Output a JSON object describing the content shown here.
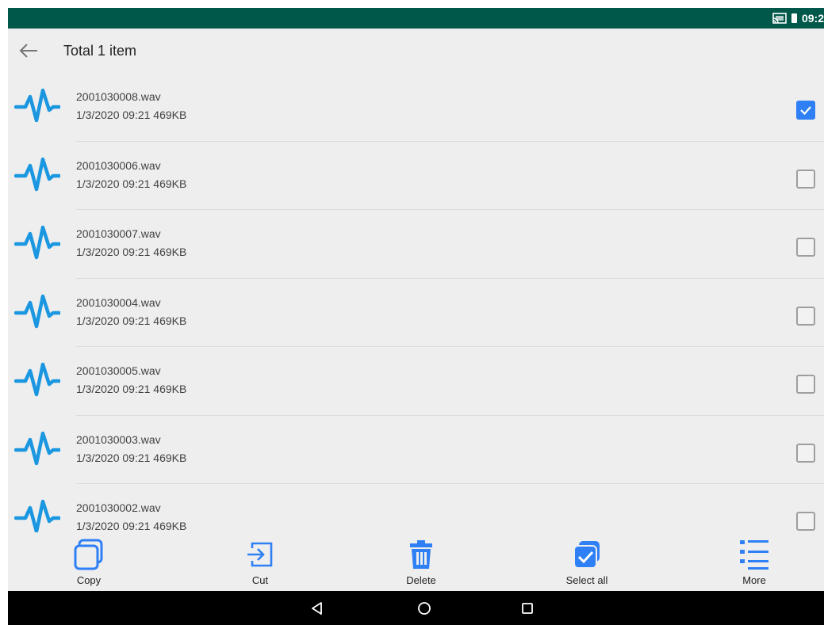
{
  "status_bar": {
    "time": "09:2",
    "icons": [
      "cast-icon",
      "battery-icon"
    ],
    "background": "#00584a"
  },
  "app_bar": {
    "title": "Total 1 item",
    "back_icon": "arrow-left-icon"
  },
  "colors": {
    "accent": "#2f7ff5",
    "wave_icon": "#1a97e0",
    "status_bar": "#00584a"
  },
  "files": [
    {
      "name": "2001030008.wav",
      "meta": "1/3/2020 09:21 469KB",
      "checked": true
    },
    {
      "name": "2001030006.wav",
      "meta": "1/3/2020 09:21 469KB",
      "checked": false
    },
    {
      "name": "2001030007.wav",
      "meta": "1/3/2020 09:21 469KB",
      "checked": false
    },
    {
      "name": "2001030004.wav",
      "meta": "1/3/2020 09:21 469KB",
      "checked": false
    },
    {
      "name": "2001030005.wav",
      "meta": "1/3/2020 09:21 469KB",
      "checked": false
    },
    {
      "name": "2001030003.wav",
      "meta": "1/3/2020 09:21 469KB",
      "checked": false
    },
    {
      "name": "2001030002.wav",
      "meta": "1/3/2020 09:21 469KB",
      "checked": false
    }
  ],
  "actions": [
    {
      "label": "Copy",
      "icon": "copy-icon"
    },
    {
      "label": "Cut",
      "icon": "cut-icon"
    },
    {
      "label": "Delete",
      "icon": "trash-icon"
    },
    {
      "label": "Select all",
      "icon": "select-all-icon"
    },
    {
      "label": "More",
      "icon": "list-icon"
    }
  ],
  "nav_bar": {
    "buttons": [
      "back-triangle-icon",
      "home-circle-icon",
      "recents-square-icon"
    ]
  }
}
